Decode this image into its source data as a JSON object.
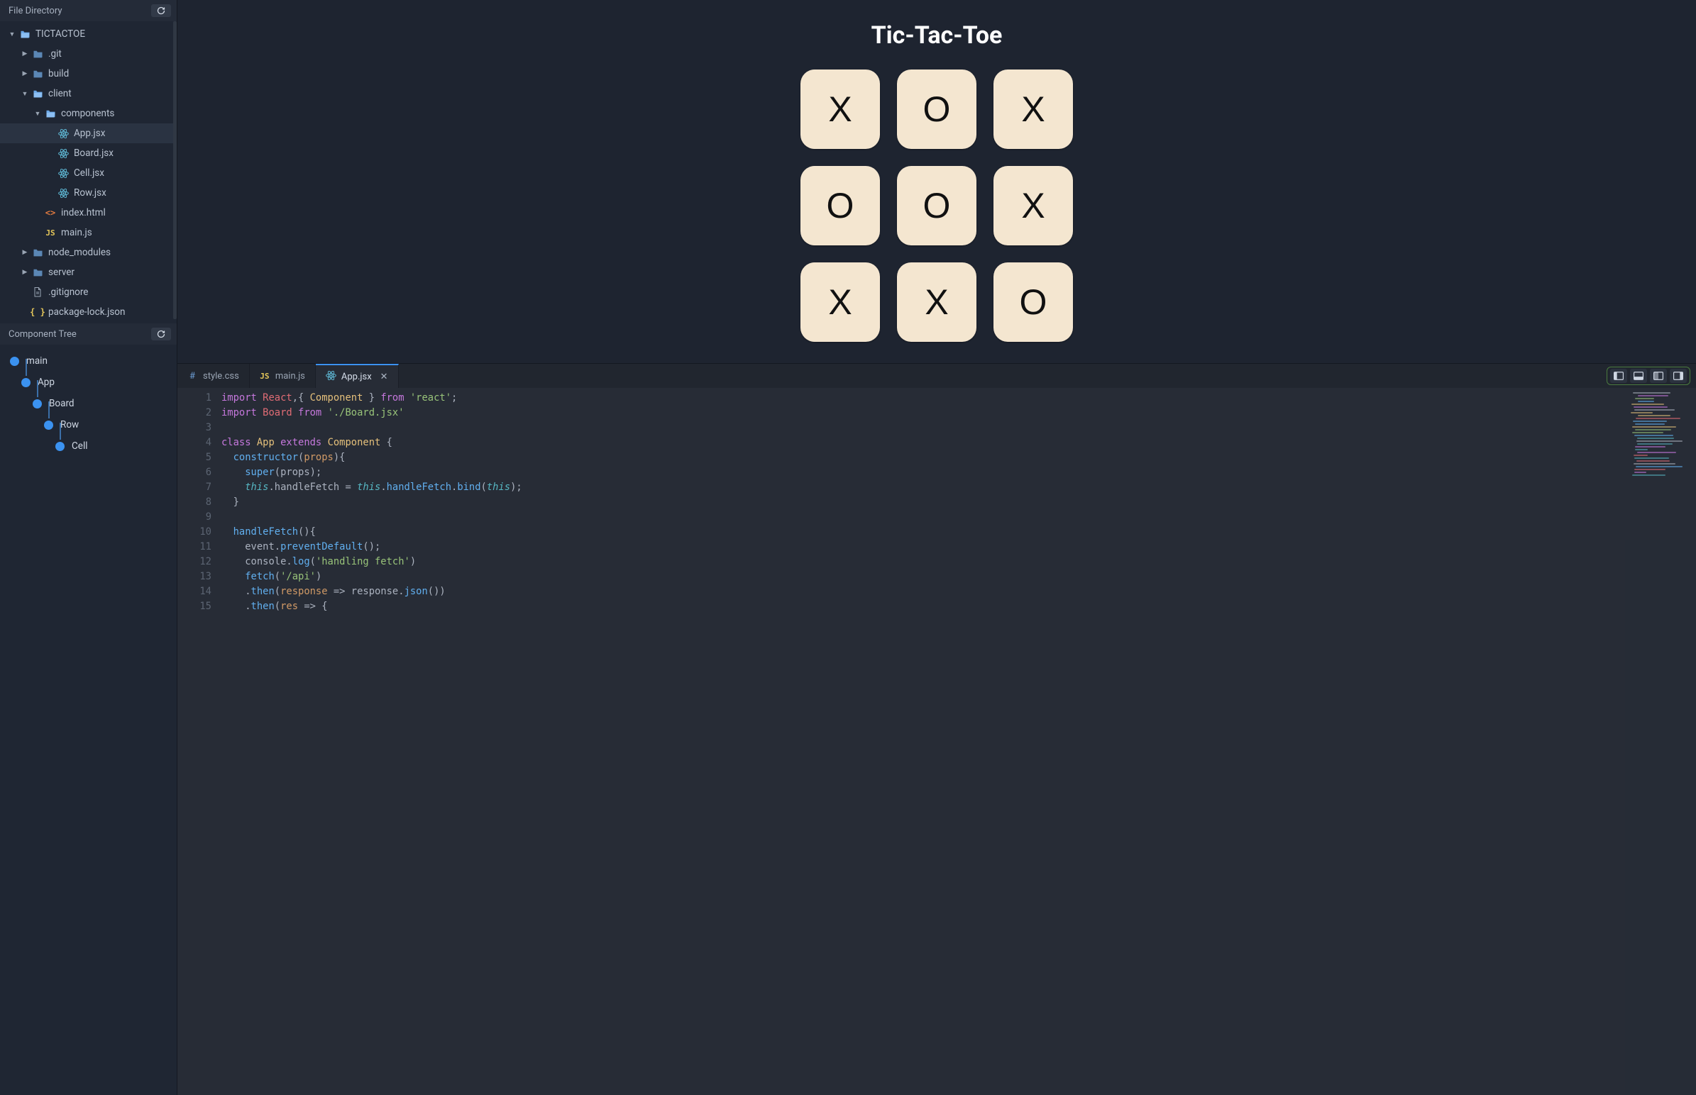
{
  "sidebar": {
    "fileDirectory": {
      "title": "File Directory",
      "tree": [
        {
          "label": "TICTACTOE",
          "icon": "folder-open",
          "depth": 0,
          "expanded": true,
          "arrow": "down"
        },
        {
          "label": ".git",
          "icon": "folder",
          "depth": 1,
          "arrow": "right"
        },
        {
          "label": "build",
          "icon": "folder",
          "depth": 1,
          "arrow": "right"
        },
        {
          "label": "client",
          "icon": "folder-open",
          "depth": 1,
          "expanded": true,
          "arrow": "down"
        },
        {
          "label": "components",
          "icon": "folder-open",
          "depth": 2,
          "expanded": true,
          "arrow": "down"
        },
        {
          "label": "App.jsx",
          "icon": "react",
          "depth": 3,
          "selected": true
        },
        {
          "label": "Board.jsx",
          "icon": "react",
          "depth": 3
        },
        {
          "label": "Cell.jsx",
          "icon": "react",
          "depth": 3
        },
        {
          "label": "Row.jsx",
          "icon": "react",
          "depth": 3
        },
        {
          "label": "index.html",
          "icon": "html",
          "depth": 2
        },
        {
          "label": "main.js",
          "icon": "js",
          "depth": 2
        },
        {
          "label": "node_modules",
          "icon": "folder",
          "depth": 1,
          "arrow": "right"
        },
        {
          "label": "server",
          "icon": "folder",
          "depth": 1,
          "arrow": "right"
        },
        {
          "label": ".gitignore",
          "icon": "file",
          "depth": 1
        },
        {
          "label": "package-lock.json",
          "icon": "json",
          "depth": 1
        }
      ]
    },
    "componentTree": {
      "title": "Component Tree",
      "nodes": [
        {
          "label": "main",
          "depth": 0
        },
        {
          "label": "App",
          "depth": 1
        },
        {
          "label": "Board",
          "depth": 2
        },
        {
          "label": "Row",
          "depth": 3
        },
        {
          "label": "Cell",
          "depth": 4
        }
      ]
    }
  },
  "preview": {
    "title": "Tic-Tac-Toe",
    "board": [
      "X",
      "O",
      "X",
      "O",
      "O",
      "X",
      "X",
      "X",
      "O"
    ]
  },
  "editor": {
    "tabs": [
      {
        "label": "style.css",
        "icon": "hash",
        "active": false
      },
      {
        "label": "main.js",
        "icon": "js",
        "active": false
      },
      {
        "label": "App.jsx",
        "icon": "react",
        "active": true,
        "closable": true
      }
    ],
    "code": [
      {
        "n": 1,
        "tokens": [
          [
            "kw",
            "import"
          ],
          [
            "plain",
            " "
          ],
          [
            "def",
            "React"
          ],
          [
            "punc",
            ",{ "
          ],
          [
            "type",
            "Component"
          ],
          [
            "punc",
            " } "
          ],
          [
            "kw",
            "from"
          ],
          [
            "plain",
            " "
          ],
          [
            "str",
            "'react'"
          ],
          [
            "punc",
            ";"
          ]
        ]
      },
      {
        "n": 2,
        "tokens": [
          [
            "kw",
            "import"
          ],
          [
            "plain",
            " "
          ],
          [
            "def",
            "Board"
          ],
          [
            "plain",
            " "
          ],
          [
            "kw",
            "from"
          ],
          [
            "plain",
            " "
          ],
          [
            "str",
            "'./Board.jsx'"
          ]
        ]
      },
      {
        "n": 3,
        "tokens": []
      },
      {
        "n": 4,
        "tokens": [
          [
            "kw",
            "class"
          ],
          [
            "plain",
            " "
          ],
          [
            "type",
            "App"
          ],
          [
            "plain",
            " "
          ],
          [
            "kw",
            "extends"
          ],
          [
            "plain",
            " "
          ],
          [
            "type",
            "Component"
          ],
          [
            "plain",
            " "
          ],
          [
            "punc",
            "{"
          ]
        ]
      },
      {
        "n": 5,
        "tokens": [
          [
            "plain",
            "  "
          ],
          [
            "fn",
            "constructor"
          ],
          [
            "punc",
            "("
          ],
          [
            "prop",
            "props"
          ],
          [
            "punc",
            "){"
          ]
        ]
      },
      {
        "n": 6,
        "tokens": [
          [
            "plain",
            "    "
          ],
          [
            "super",
            "super"
          ],
          [
            "punc",
            "("
          ],
          [
            "plain",
            "props"
          ],
          [
            "punc",
            ");"
          ]
        ]
      },
      {
        "n": 7,
        "tokens": [
          [
            "plain",
            "    "
          ],
          [
            "this",
            "this"
          ],
          [
            "punc",
            "."
          ],
          [
            "plain",
            "handleFetch"
          ],
          [
            "punc",
            " = "
          ],
          [
            "this",
            "this"
          ],
          [
            "punc",
            "."
          ],
          [
            "fn",
            "handleFetch"
          ],
          [
            "punc",
            "."
          ],
          [
            "fn",
            "bind"
          ],
          [
            "punc",
            "("
          ],
          [
            "this",
            "this"
          ],
          [
            "punc",
            ");"
          ]
        ]
      },
      {
        "n": 8,
        "tokens": [
          [
            "plain",
            "  "
          ],
          [
            "punc",
            "}"
          ]
        ]
      },
      {
        "n": 9,
        "tokens": []
      },
      {
        "n": 10,
        "tokens": [
          [
            "plain",
            "  "
          ],
          [
            "fn",
            "handleFetch"
          ],
          [
            "punc",
            "(){"
          ]
        ]
      },
      {
        "n": 11,
        "tokens": [
          [
            "plain",
            "    "
          ],
          [
            "plain",
            "event"
          ],
          [
            "punc",
            "."
          ],
          [
            "fn",
            "preventDefault"
          ],
          [
            "punc",
            "();"
          ]
        ]
      },
      {
        "n": 12,
        "tokens": [
          [
            "plain",
            "    "
          ],
          [
            "plain",
            "console"
          ],
          [
            "punc",
            "."
          ],
          [
            "fn",
            "log"
          ],
          [
            "punc",
            "("
          ],
          [
            "str",
            "'handling fetch'"
          ],
          [
            "punc",
            ")"
          ]
        ]
      },
      {
        "n": 13,
        "tokens": [
          [
            "plain",
            "    "
          ],
          [
            "fn",
            "fetch"
          ],
          [
            "punc",
            "("
          ],
          [
            "str",
            "'/api'"
          ],
          [
            "punc",
            ")"
          ]
        ]
      },
      {
        "n": 14,
        "tokens": [
          [
            "plain",
            "    "
          ],
          [
            "punc",
            "."
          ],
          [
            "fn",
            "then"
          ],
          [
            "punc",
            "("
          ],
          [
            "prop",
            "response"
          ],
          [
            "plain",
            " "
          ],
          [
            "punc",
            "=>"
          ],
          [
            "plain",
            " response"
          ],
          [
            "punc",
            "."
          ],
          [
            "fn",
            "json"
          ],
          [
            "punc",
            "())"
          ]
        ]
      },
      {
        "n": 15,
        "tokens": [
          [
            "plain",
            "    "
          ],
          [
            "punc",
            "."
          ],
          [
            "fn",
            "then"
          ],
          [
            "punc",
            "("
          ],
          [
            "prop",
            "res"
          ],
          [
            "plain",
            " "
          ],
          [
            "punc",
            "=>"
          ],
          [
            "plain",
            " "
          ],
          [
            "punc",
            "{"
          ]
        ]
      }
    ]
  }
}
